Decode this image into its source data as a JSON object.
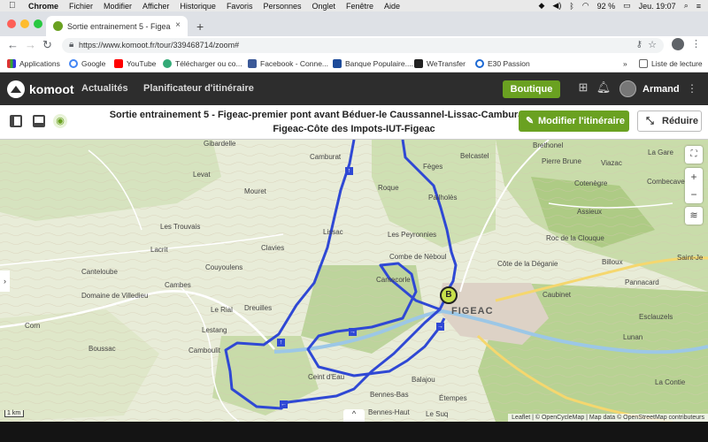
{
  "menubar": {
    "apple": "",
    "items": [
      "Chrome",
      "Fichier",
      "Modifier",
      "Afficher",
      "Historique",
      "Favoris",
      "Personnes",
      "Onglet",
      "Fenêtre",
      "Aide"
    ],
    "battery": "92 %",
    "clock": "Jeu. 19:07"
  },
  "tab": {
    "title": "Sortie entrainement 5 - Figea",
    "close": "×",
    "new_tab": "+"
  },
  "omnibox": {
    "url": "https://www.komoot.fr/tour/339468714/zoom#"
  },
  "bookmarks": {
    "items": [
      "Applications",
      "Google",
      "YouTube",
      "Télécharger ou co...",
      "Facebook - Conne...",
      "Banque Populaire....",
      "WeTransfer",
      "E30 Passion"
    ],
    "more": "»",
    "reading_list": "Liste de lecture"
  },
  "komoot": {
    "logo": "komoot",
    "nav": [
      "Actualités",
      "Planificateur d'itinéraire"
    ],
    "shop_label": "Boutique",
    "user_name": "Armand"
  },
  "tour": {
    "title_line1": "Sortie entrainement 5 - Figeac-premier pont avant Béduer-le Caussannel-Lissac-Camburat-Côte de Naudi-",
    "title_line2": "Figeac-Côte des Impots-IUT-Figeac",
    "edit_label": "Modifier l'itinéraire",
    "reduce_label": "Réduire"
  },
  "map": {
    "labels": [
      "Gibardelle",
      "Camburat",
      "Fèges",
      "Belcastel",
      "Brethonel",
      "Pierre Brune",
      "Viazac",
      "La Gare",
      "Levat",
      "Mouret",
      "Roque",
      "Pailholès",
      "Cotenègre",
      "Combecave",
      "Assieux",
      "Les Trouvais",
      "Lissac",
      "Les Peyronnies",
      "Roc de la Clouque",
      "Lacrit",
      "Clavies",
      "Combe de Nèboul",
      "Côte de la Déganie",
      "Billoux",
      "Saint-Je",
      "Canteloube",
      "Couyoulens",
      "Cantecorle",
      "Cambes",
      "Caubinet",
      "Pannacard",
      "Domaine de Villedieu",
      "Le Rial",
      "Dreuilles",
      "FIGEAC",
      "Esclauzels",
      "Corn",
      "Lestang",
      "Boussac",
      "Camboulit",
      "Lunan",
      "Ceint d'Eau",
      "La Contie",
      "Balajou",
      "Bennes-Bas",
      "Étempes",
      "Bennes-Haut",
      "Le Suq"
    ],
    "waypoint": "B",
    "scale": "1 km",
    "attribution": "Leaflet | © OpenCycleMap | Map data © OpenStreetMap contributeurs",
    "route_color": "#2f48d4"
  },
  "controls": {
    "zoom_in": "+",
    "zoom_out": "−",
    "side_arrow": "›",
    "bottom_chevron": "^"
  }
}
